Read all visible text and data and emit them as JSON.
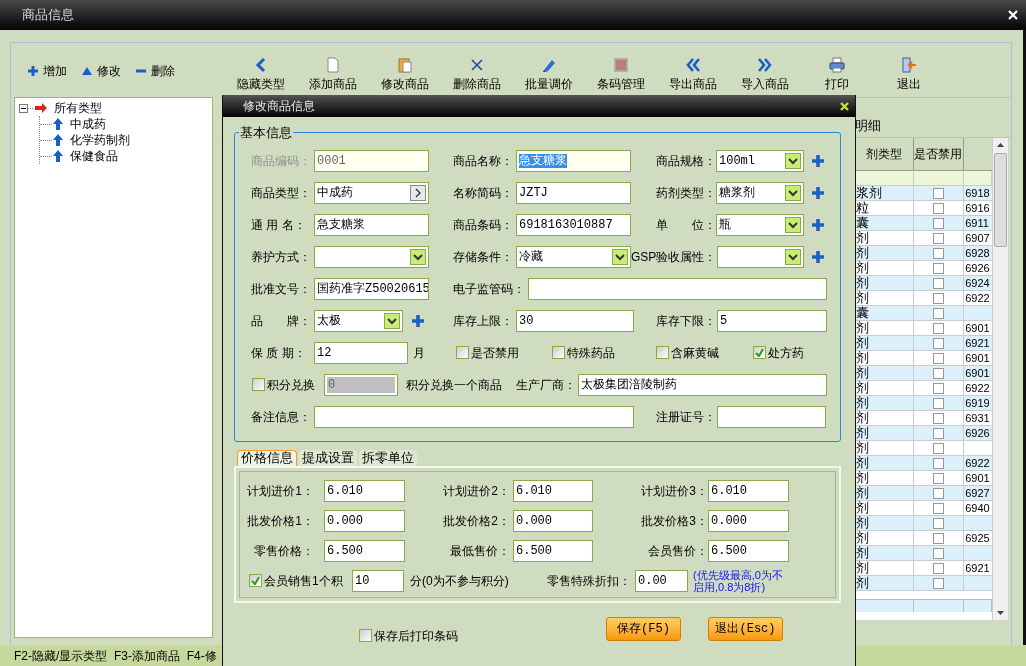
{
  "window": {
    "title": "商品信息"
  },
  "toolbar_left": [
    {
      "label": "增加"
    },
    {
      "label": "修改"
    },
    {
      "label": "删除"
    }
  ],
  "toolbar": [
    {
      "label": "隐藏类型"
    },
    {
      "label": "添加商品"
    },
    {
      "label": "修改商品"
    },
    {
      "label": "删除商品"
    },
    {
      "label": "批量调价"
    },
    {
      "label": "条码管理"
    },
    {
      "label": "导出商品"
    },
    {
      "label": "导入商品"
    },
    {
      "label": "打印"
    },
    {
      "label": "退出"
    }
  ],
  "category_tree": {
    "label": "所有类型",
    "expanded": true,
    "children": [
      {
        "label": "中成药"
      },
      {
        "label": "化学药制剂"
      },
      {
        "label": "保健食品"
      }
    ]
  },
  "product_list": {
    "caption": "明细",
    "columns": [
      "剂类型",
      "是否禁用"
    ],
    "rows": [
      {
        "type": "浆剂",
        "checked": false,
        "barcode": "6918"
      },
      {
        "type": "粒",
        "checked": false,
        "barcode": "6916"
      },
      {
        "type": "囊",
        "checked": false,
        "barcode": "6911"
      },
      {
        "type": "剂",
        "checked": false,
        "barcode": "6907"
      },
      {
        "type": "剂",
        "checked": false,
        "barcode": "6928"
      },
      {
        "type": "剂",
        "checked": false,
        "barcode": "6926"
      },
      {
        "type": "剂",
        "checked": false,
        "barcode": "6924"
      },
      {
        "type": "剂",
        "checked": false,
        "barcode": "6922"
      },
      {
        "type": "囊",
        "checked": false
      },
      {
        "type": "剂",
        "checked": false,
        "barcode": "6901"
      },
      {
        "type": "剂",
        "checked": false,
        "barcode": "6921"
      },
      {
        "type": "剂",
        "checked": false,
        "barcode": "6901"
      },
      {
        "type": "剂",
        "checked": false,
        "barcode": "6901"
      },
      {
        "type": "剂",
        "checked": false,
        "barcode": "6922"
      },
      {
        "type": "剂",
        "checked": false,
        "barcode": "6919"
      },
      {
        "type": "剂",
        "checked": false,
        "barcode": "6931"
      },
      {
        "type": "剂",
        "checked": false,
        "barcode": "6926"
      },
      {
        "type": "剂",
        "checked": false
      },
      {
        "type": "剂",
        "checked": false,
        "barcode": "6922"
      },
      {
        "type": "剂",
        "checked": false,
        "barcode": "6901"
      },
      {
        "type": "剂",
        "checked": false,
        "barcode": "6927"
      },
      {
        "type": "剂",
        "checked": false,
        "barcode": "6940"
      },
      {
        "type": "剂",
        "checked": false
      },
      {
        "type": "剂",
        "checked": false,
        "barcode": "6925"
      },
      {
        "type": "剂",
        "checked": false
      },
      {
        "type": "剂",
        "checked": false,
        "barcode": "6921"
      },
      {
        "type": "剂",
        "checked": false
      }
    ]
  },
  "status_bar": "F2-隐藏/显示类型  F3-添加商品  F4-修",
  "dialog": {
    "title": "修改商品信息",
    "basic_info": {
      "title": "基本信息",
      "rows": [
        {
          "fields": [
            {
              "kind": "label",
              "text": "商品编码：",
              "disabled": true
            },
            {
              "kind": "text",
              "value": "0001",
              "disabled": true
            },
            {
              "kind": "label",
              "text": "商品名称："
            },
            {
              "kind": "text",
              "value": "急支糖浆",
              "focused": true
            },
            {
              "kind": "label",
              "text": "商品规格："
            },
            {
              "kind": "select",
              "value": "100ml"
            },
            {
              "kind": "add"
            }
          ]
        },
        {
          "fields": [
            {
              "kind": "label",
              "text": "商品类型："
            },
            {
              "kind": "picker",
              "value": "中成药"
            },
            {
              "kind": "label",
              "text": "名称简码："
            },
            {
              "kind": "text",
              "value": "JZTJ"
            },
            {
              "kind": "label",
              "text": "药剂类型："
            },
            {
              "kind": "select",
              "value": "糖浆剂"
            },
            {
              "kind": "add"
            }
          ]
        },
        {
          "fields": [
            {
              "kind": "label",
              "text": "通 用 名："
            },
            {
              "kind": "text",
              "value": "急支糖浆"
            },
            {
              "kind": "label",
              "text": "商品条码："
            },
            {
              "kind": "text",
              "value": "6918163010887"
            },
            {
              "kind": "label",
              "text": "单　　位："
            },
            {
              "kind": "select",
              "value": "瓶"
            },
            {
              "kind": "add"
            }
          ]
        },
        {
          "fields": [
            {
              "kind": "label",
              "text": "养护方式："
            },
            {
              "kind": "select"
            },
            {
              "kind": "label",
              "text": "存储条件："
            },
            {
              "kind": "select",
              "value": "冷藏"
            },
            {
              "kind": "label",
              "text": "GSP验收属性："
            },
            {
              "kind": "select"
            },
            {
              "kind": "add"
            }
          ]
        },
        {
          "fields": [
            {
              "kind": "label",
              "text": "批准文号："
            },
            {
              "kind": "text",
              "value": "国药准字Z50020615"
            },
            {
              "kind": "label",
              "text": "电子监管码："
            },
            {
              "kind": "text"
            }
          ]
        },
        {
          "fields": [
            {
              "kind": "label",
              "text": "品　　牌："
            },
            {
              "kind": "select",
              "value": "太极"
            },
            {
              "kind": "add"
            },
            {
              "kind": "label",
              "text": "库存上限："
            },
            {
              "kind": "text",
              "value": "30"
            },
            {
              "kind": "label",
              "text": "库存下限："
            },
            {
              "kind": "text",
              "value": "5"
            }
          ]
        },
        {
          "fields": [
            {
              "kind": "label",
              "text": "保 质 期："
            },
            {
              "kind": "text",
              "value": "12"
            },
            {
              "kind": "label",
              "text": "月"
            },
            {
              "kind": "check",
              "text": "是否禁用",
              "checked": false
            },
            {
              "kind": "check",
              "text": "特殊药品",
              "checked": false
            },
            {
              "kind": "check",
              "text": "含麻黄碱",
              "checked": false
            },
            {
              "kind": "check",
              "text": "处方药",
              "checked": true
            }
          ]
        },
        {
          "fields": [
            {
              "kind": "check",
              "text": "积分兑换",
              "checked": false
            },
            {
              "kind": "text",
              "value": "0",
              "disabled": true
            },
            {
              "kind": "label",
              "text": "积分兑换一个商品"
            },
            {
              "kind": "label",
              "text": "生产厂商："
            },
            {
              "kind": "text",
              "value": "太极集团涪陵制药"
            }
          ]
        },
        {
          "fields": [
            {
              "kind": "label",
              "text": "备注信息："
            },
            {
              "kind": "text"
            },
            {
              "kind": "label",
              "text": "注册证号："
            },
            {
              "kind": "text"
            }
          ]
        }
      ]
    },
    "tabs": [
      {
        "label": "价格信息",
        "selected": true
      },
      {
        "label": "提成设置",
        "selected": false
      },
      {
        "label": "拆零单位",
        "selected": false
      }
    ],
    "price_rows": [
      {
        "fields": [
          {
            "kind": "label",
            "text": "计划进价1："
          },
          {
            "kind": "text",
            "value": "6.010"
          },
          {
            "kind": "label",
            "text": "计划进价2："
          },
          {
            "kind": "text",
            "value": "6.010"
          },
          {
            "kind": "label",
            "text": "计划进价3："
          },
          {
            "kind": "text",
            "value": "6.010"
          }
        ]
      },
      {
        "fields": [
          {
            "kind": "label",
            "text": "批发价格1："
          },
          {
            "kind": "text",
            "value": "0.000"
          },
          {
            "kind": "label",
            "text": "批发价格2："
          },
          {
            "kind": "text",
            "value": "0.000"
          },
          {
            "kind": "label",
            "text": "批发价格3："
          },
          {
            "kind": "text",
            "value": "0.000"
          }
        ]
      },
      {
        "fields": [
          {
            "kind": "label",
            "text": "零售价格："
          },
          {
            "kind": "text",
            "value": "6.500"
          },
          {
            "kind": "label",
            "text": "最低售价："
          },
          {
            "kind": "text",
            "value": "6.500"
          },
          {
            "kind": "label",
            "text": "会员售价："
          },
          {
            "kind": "text",
            "value": "6.500"
          }
        ]
      },
      {
        "fields": [
          {
            "kind": "check",
            "text": "会员销售1个积",
            "checked": true
          },
          {
            "kind": "text",
            "value": "10"
          },
          {
            "kind": "label",
            "text": "分(0为不参与积分)"
          },
          {
            "kind": "label",
            "text": "零售特殊折扣："
          },
          {
            "kind": "text",
            "value": "0.00"
          },
          {
            "kind": "note",
            "text": "(优先级最高,0为不启用,0.8为8折)"
          }
        ]
      }
    ],
    "print_after_save": {
      "label": "保存后打印条码",
      "checked": false
    },
    "buttons": [
      "保存(F5)",
      "退出(Esc)"
    ]
  }
}
